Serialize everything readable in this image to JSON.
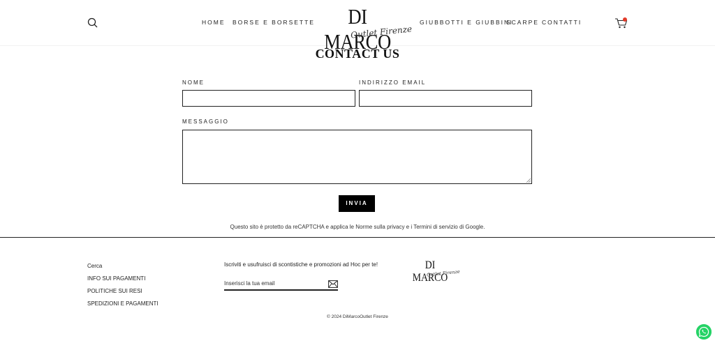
{
  "header": {
    "logo_main": "DI MARCO",
    "logo_sub": "Outlet Firenze",
    "nav": {
      "home": "HOME",
      "borse": "BORSE E BORSETTE",
      "giubbotti": "GIUBBOTTI E GIUBBINI",
      "scarpe": "SCARPE",
      "contatti": "CONTATTI"
    },
    "cart_badge_color": "#e23b2a"
  },
  "main": {
    "title": "CONTACT US",
    "name_label": "NOME",
    "email_label": "INDIRIZZO EMAIL",
    "message_label": "MESSAGGIO",
    "submit_label": "INVIA",
    "recaptcha_notice": "Questo sito è protetto da reCAPTCHA e applica le Norme sulla privacy e i Termini di servizio di Google."
  },
  "footer": {
    "links": {
      "cerca": "Cerca",
      "pagamenti": "INFO SUI PAGAMENTI",
      "resi": "POLITICHE SUI RESI",
      "spedizioni": "SPEDIZIONI E PAGAMENTI"
    },
    "newsletter_text": "Iscriviti e usufruisci di scontistiche e promozioni ad Hoc per te!",
    "newsletter_placeholder": "Inserisci la tua email",
    "logo_main": "DI MARCO",
    "logo_sub": "Outlet Firenze",
    "copyright": "© 2024 DiMarcoOutlet Firenze"
  },
  "icons": {
    "search": "search-icon",
    "cart": "cart-icon",
    "newsletter_submit": "envelope-icon",
    "chat": "whatsapp-icon"
  },
  "colors": {
    "accent": "#000000",
    "whatsapp": "#25d366"
  }
}
